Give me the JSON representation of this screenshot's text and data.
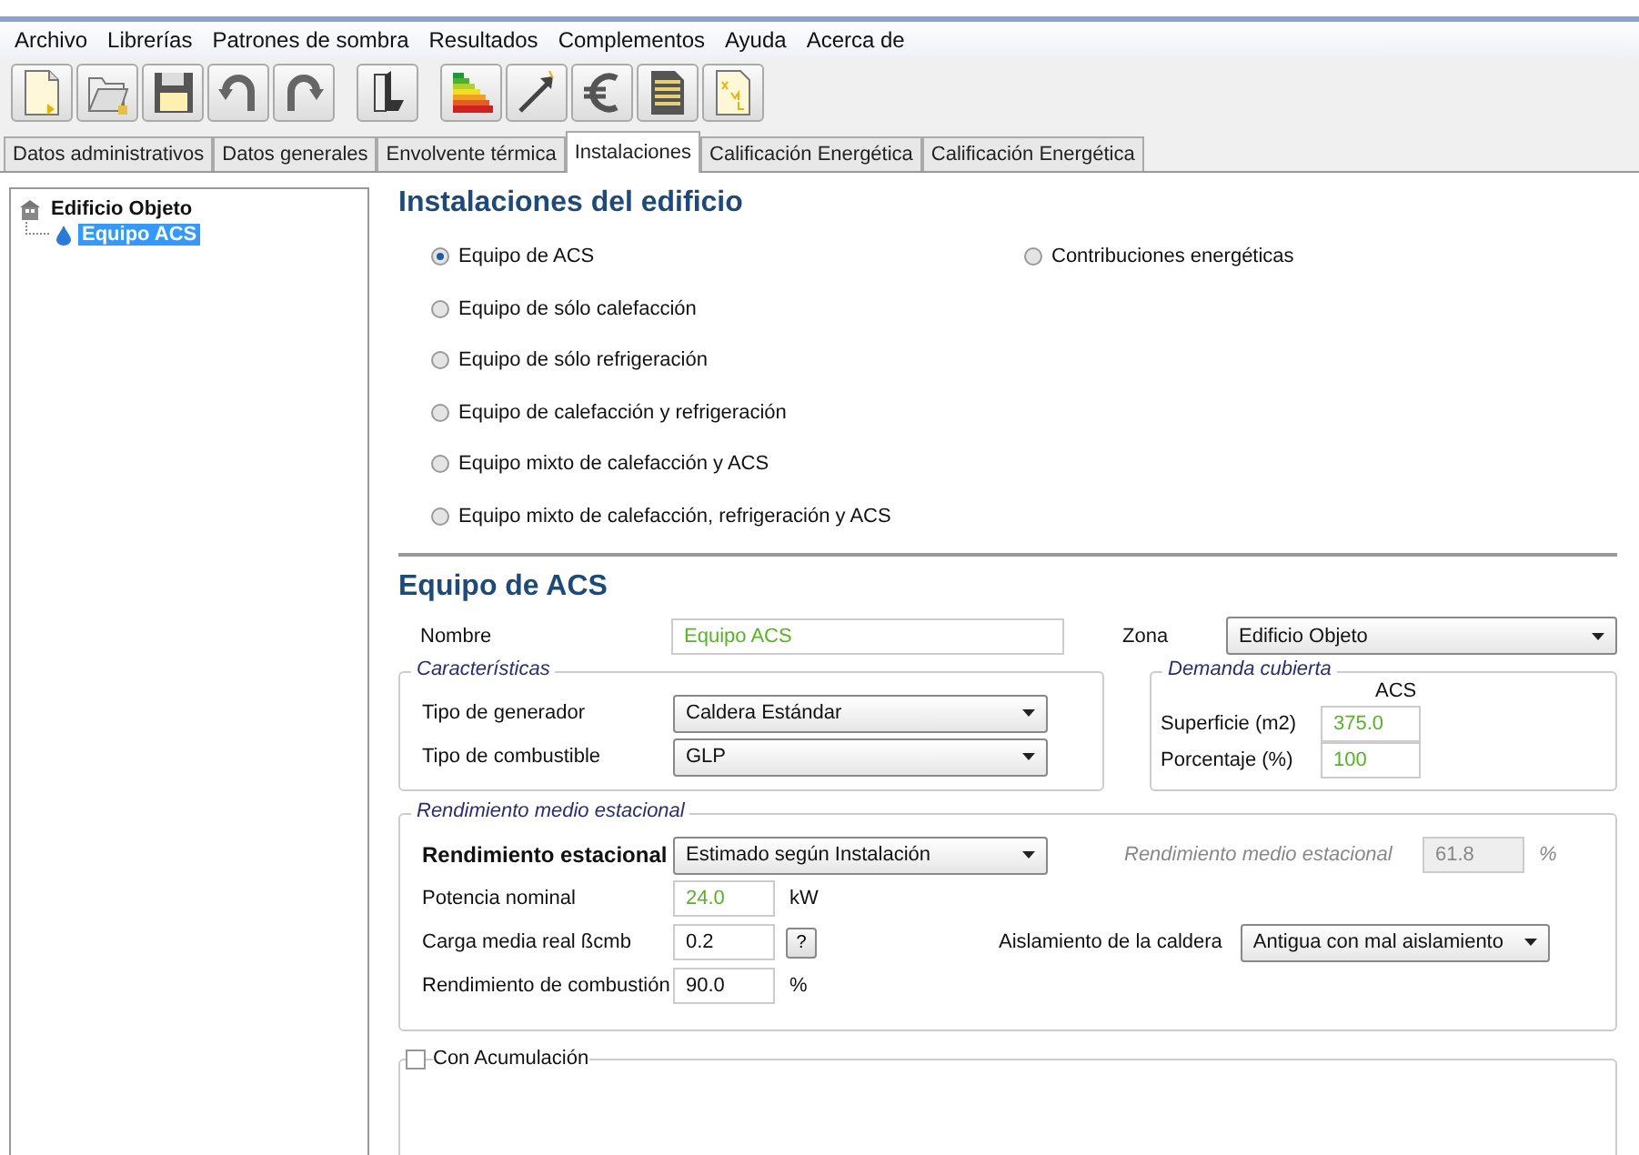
{
  "menu": [
    "Archivo",
    "Librerías",
    "Patrones de sombra",
    "Resultados",
    "Complementos",
    "Ayuda",
    "Acerca de"
  ],
  "tabs": [
    {
      "label": "Datos administrativos",
      "selected": false
    },
    {
      "label": "Datos generales",
      "selected": false
    },
    {
      "label": "Envolvente térmica",
      "selected": false
    },
    {
      "label": "Instalaciones",
      "selected": true
    },
    {
      "label": "Calificación Energética",
      "selected": false
    },
    {
      "label": "Calificación Energética",
      "selected": false
    }
  ],
  "tree": [
    {
      "label": "Edificio Objeto",
      "selected": false,
      "children": [
        {
          "label": "Equipo ACS",
          "selected": true
        }
      ]
    }
  ],
  "installations": {
    "title": "Instalaciones del edificio",
    "radio_columns": [
      [
        {
          "label": "Equipo de ACS",
          "selected": true
        },
        {
          "label": "Equipo de sólo calefacción",
          "selected": false
        },
        {
          "label": "Equipo de sólo refrigeración",
          "selected": false
        },
        {
          "label": "Equipo de calefacción y refrigeración",
          "selected": false
        },
        {
          "label": "Equipo mixto de calefacción y ACS",
          "selected": false
        },
        {
          "label": "Equipo mixto de calefacción, refrigeración y ACS",
          "selected": false
        }
      ],
      [
        {
          "label": "Contribuciones energéticas",
          "selected": false
        }
      ]
    ]
  },
  "equipment": {
    "title": "Equipo de ACS",
    "name": {
      "label": "Nombre",
      "value": "Equipo ACS",
      "default_value": true
    },
    "zone": {
      "label": "Zona",
      "value": "Edificio Objeto"
    },
    "characteristics": {
      "title": "Características",
      "rows": [
        {
          "label": "Tipo de generador",
          "value": "Caldera Estándar"
        },
        {
          "label": "Tipo de combustible",
          "value": "GLP"
        }
      ]
    },
    "demand": {
      "title": "Demanda cubierta",
      "column_header": "ACS",
      "rows": [
        {
          "label": "Superficie (m2)",
          "value": "375.0",
          "default_value": true
        },
        {
          "label": "Porcentaje (%)",
          "value": "100",
          "default_value": true
        }
      ]
    },
    "performance": {
      "title": "Rendimiento medio estacional",
      "mode": {
        "label": "Rendimiento estacional",
        "value": "Estimado según Instalación"
      },
      "readout": {
        "label": "Rendimiento medio estacional",
        "value": "61.8",
        "unit": "%",
        "disabled": true
      },
      "nominal_power": {
        "label": "Potencia nominal",
        "value": "24.0",
        "unit": "kW",
        "default_value": true
      },
      "load": {
        "label": "Carga media real ßcmb",
        "value": "0.2",
        "help": "?",
        "default_value": false
      },
      "combustion": {
        "label": "Rendimiento de combustión",
        "value": "90.0",
        "unit": "%",
        "default_value": false
      },
      "insulation": {
        "label": "Aislamiento de la caldera",
        "value": "Antigua con mal aislamiento"
      }
    },
    "storage": {
      "label": "Con Acumulación",
      "checked": false
    }
  }
}
